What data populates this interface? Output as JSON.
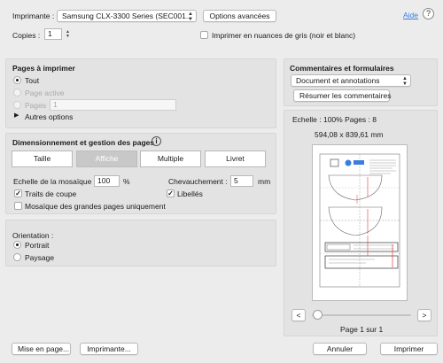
{
  "printer": {
    "label": "Imprimante :",
    "value": "Samsung CLX-3300 Series (SEC001..."
  },
  "advanced_button": "Options avancées",
  "help_link": "Aide",
  "copies": {
    "label": "Copies :",
    "value": "1"
  },
  "grayscale_label": "Imprimer en nuances de gris (noir et blanc)",
  "pages": {
    "title": "Pages à imprimer",
    "all_label": "Tout",
    "current_label": "Page active",
    "pages_label": "Pages",
    "pages_value": "1",
    "more_label": "Autres options"
  },
  "sizing": {
    "title": "Dimensionnement et gestion des pages",
    "tabs": [
      "Taille",
      "Affiche",
      "Multiple",
      "Livret"
    ],
    "selected_tab": "Affiche",
    "tile_scale_label": "Echelle de la mosaïque :",
    "tile_scale_value": "100",
    "tile_scale_unit": "%",
    "overlap_label": "Chevauchement :",
    "overlap_value": "5",
    "overlap_unit": "mm",
    "cut_marks_label": "Traits de coupe",
    "labels_label": "Libellés",
    "large_pages_label": "Mosaïque des grandes pages uniquement"
  },
  "orientation": {
    "title": "Orientation :",
    "portrait_label": "Portrait",
    "landscape_label": "Paysage"
  },
  "comments": {
    "title": "Commentaires et formulaires",
    "select_value": "Document et annotations",
    "summarize_button": "Résumer les commentaires"
  },
  "preview": {
    "scale_text": "Echelle : 100% Pages : 8",
    "dimensions_text": "594,08 x 839,61 mm",
    "prev_button": "<",
    "next_button": ">",
    "page_indicator": "Page 1 sur 1",
    "slider_value": 0
  },
  "footer": {
    "page_setup_button": "Mise en page...",
    "printer_button": "Imprimante...",
    "cancel_button": "Annuler",
    "print_button": "Imprimer"
  },
  "colors": {
    "accent": "#3b7ddd",
    "cut_line": "#e23b3b"
  }
}
